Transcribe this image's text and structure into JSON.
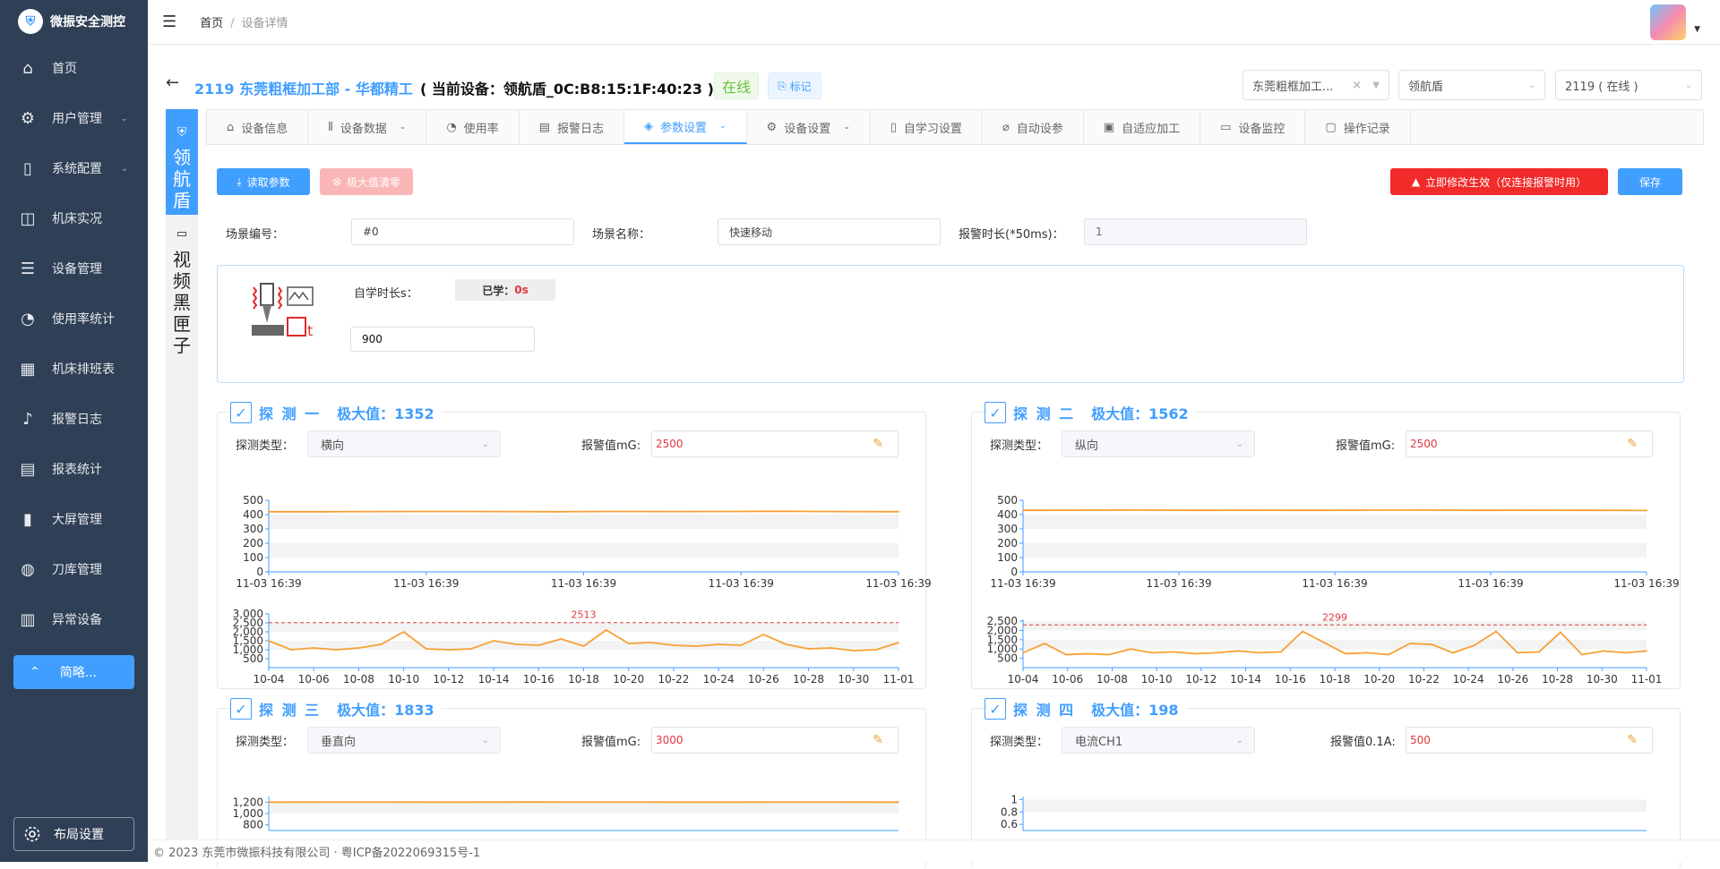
{
  "app": {
    "title": "微振安全测控"
  },
  "sidebar": {
    "items": [
      {
        "label": "首页",
        "icon": "home-icon"
      },
      {
        "label": "用户管理",
        "icon": "gear-icon",
        "has_children": true
      },
      {
        "label": "系统配置",
        "icon": "book-icon",
        "has_children": true
      },
      {
        "label": "机床实况",
        "icon": "monitor-chart-icon"
      },
      {
        "label": "设备管理",
        "icon": "list-icon"
      },
      {
        "label": "使用率统计",
        "icon": "gauge-icon"
      },
      {
        "label": "机床排班表",
        "icon": "calendar-icon"
      },
      {
        "label": "报警日志",
        "icon": "bell-icon"
      },
      {
        "label": "报表统计",
        "icon": "report-icon"
      },
      {
        "label": "大屏管理",
        "icon": "bar-chart-icon"
      },
      {
        "label": "刀库管理",
        "icon": "globe-icon"
      },
      {
        "label": "异常设备",
        "icon": "device-alert-icon"
      }
    ],
    "collapse_label": "简略...",
    "layout_label": "布局设置"
  },
  "breadcrumb": {
    "home": "首页",
    "current": "设备详情"
  },
  "header": {
    "title": "2119 东莞粗框加工部 - 华都精工",
    "device": "( 当前设备：领航盾_0C:B8:15:1F:40:23 )",
    "status": "在线",
    "mark": "标记"
  },
  "selectors": {
    "company": "东莞粗框加工...",
    "product": "领航盾",
    "machine": "2119 ( 在线 )"
  },
  "side_tabs": {
    "primary": [
      "领",
      "航",
      "盾"
    ],
    "secondary": [
      "视",
      "频",
      "黑",
      "匣",
      "子"
    ]
  },
  "tabs": [
    {
      "label": "设备信息",
      "icon": "home-icon",
      "dropdown": false,
      "active": false
    },
    {
      "label": "设备数据",
      "icon": "bar-icon",
      "dropdown": true,
      "active": false
    },
    {
      "label": "使用率",
      "icon": "pie-icon",
      "dropdown": false,
      "active": false
    },
    {
      "label": "报警日志",
      "icon": "doc-icon",
      "dropdown": false,
      "active": false
    },
    {
      "label": "参数设置",
      "icon": "layers-icon",
      "dropdown": true,
      "active": true
    },
    {
      "label": "设备设置",
      "icon": "gear-icon",
      "dropdown": true,
      "active": false
    },
    {
      "label": "自学习设置",
      "icon": "book-icon",
      "dropdown": false,
      "active": false
    },
    {
      "label": "自动设参",
      "icon": "clip-icon",
      "dropdown": false,
      "active": false
    },
    {
      "label": "自适应加工",
      "icon": "box-icon",
      "dropdown": false,
      "active": false
    },
    {
      "label": "设备监控",
      "icon": "video-icon",
      "dropdown": false,
      "active": false
    },
    {
      "label": "操作记录",
      "icon": "file-icon",
      "dropdown": false,
      "active": false
    }
  ],
  "toolbar": {
    "read_params": "读取参数",
    "clear_max": "极大值清零",
    "apply_now": "立即修改生效（仅连接报警时用）",
    "save": "保存"
  },
  "params": {
    "scene_no_label": "场景编号：",
    "scene_no": "#0",
    "scene_name_label": "场景名称：",
    "scene_name": "快速移动",
    "alarm_dur_label": "报警时长(*50ms)：",
    "alarm_dur": "1"
  },
  "learn": {
    "label": "自学时长s：",
    "learned_prefix": "已学：",
    "learned_value": "0s",
    "value": "900"
  },
  "colors": {
    "accent": "#409eff",
    "danger": "#e0393e",
    "line": "#f7a035",
    "online": "#67c23a"
  },
  "panels": [
    {
      "title": "探 测 一",
      "max_label": "极大值：1352",
      "type_label": "探测类型：",
      "type_value": "横向",
      "alarm_label": "报警值mG:",
      "alarm_value": "2500"
    },
    {
      "title": "探 测 二",
      "max_label": "极大值：1562",
      "type_label": "探测类型：",
      "type_value": "纵向",
      "alarm_label": "报警值mG:",
      "alarm_value": "2500"
    },
    {
      "title": "探 测 三",
      "max_label": "极大值：1833",
      "type_label": "探测类型：",
      "type_value": "垂直向",
      "alarm_label": "报警值mG:",
      "alarm_value": "3000"
    },
    {
      "title": "探 测 四",
      "max_label": "极大值：198",
      "type_label": "探测类型：",
      "type_value": "电流CH1",
      "alarm_label": "报警值0.1A:",
      "alarm_value": "500"
    }
  ],
  "chart_data": [
    {
      "type": "line",
      "x": [
        "11-03 16:39",
        "11-03 16:39",
        "11-03 16:39",
        "11-03 16:39",
        "11-03 16:39"
      ],
      "y_ticks": [
        0,
        100,
        200,
        300,
        400,
        500
      ],
      "ylim": [
        0,
        500
      ],
      "values": [
        420,
        420,
        421,
        422,
        421,
        420,
        422,
        421,
        422,
        423,
        421,
        420
      ]
    },
    {
      "type": "line",
      "x": [
        "10-04",
        "10-06",
        "10-08",
        "10-10",
        "10-12",
        "10-14",
        "10-16",
        "10-18",
        "10-20",
        "10-22",
        "10-24",
        "10-26",
        "10-28",
        "10-30",
        "11-01"
      ],
      "y_ticks": [
        500,
        1000,
        1500,
        2000,
        2500,
        3000
      ],
      "y_tick_labels": [
        "500",
        "1,000",
        "1,500",
        "2,000",
        "2,500",
        "3,000"
      ],
      "ylim": [
        0,
        3000
      ],
      "threshold": 2513,
      "threshold_label": "2513",
      "values": [
        1500,
        1000,
        1100,
        1000,
        1100,
        1300,
        2000,
        1050,
        1000,
        1050,
        1500,
        1300,
        1250,
        1600,
        1200,
        2100,
        1350,
        1400,
        1250,
        1200,
        1300,
        1250,
        1850,
        1300,
        1050,
        1100,
        950,
        1000,
        1400
      ]
    },
    {
      "type": "line",
      "x": [
        "11-03 16:39",
        "11-03 16:39",
        "11-03 16:39",
        "11-03 16:39",
        "11-03 16:39"
      ],
      "y_ticks": [
        0,
        100,
        200,
        300,
        400,
        500
      ],
      "ylim": [
        0,
        500
      ],
      "values": [
        430,
        431,
        432,
        430,
        431,
        430,
        431,
        432,
        430,
        431,
        430,
        429
      ]
    },
    {
      "type": "line",
      "x": [
        "10-04",
        "10-06",
        "10-08",
        "10-10",
        "10-12",
        "10-14",
        "10-16",
        "10-18",
        "10-20",
        "10-22",
        "10-24",
        "10-26",
        "10-28",
        "10-30",
        "11-01"
      ],
      "y_ticks": [
        500,
        1000,
        1500,
        2000,
        2500
      ],
      "y_tick_labels": [
        "500",
        "1,000",
        "1,500",
        "2,000",
        "2,500"
      ],
      "ylim": [
        0,
        2600
      ],
      "threshold": 2299,
      "threshold_label": "2299",
      "values": [
        800,
        1300,
        700,
        750,
        700,
        1000,
        800,
        850,
        750,
        800,
        900,
        800,
        850,
        1950,
        1350,
        750,
        800,
        700,
        1300,
        1250,
        800,
        1200,
        1950,
        800,
        850,
        1900,
        700,
        900,
        800,
        900
      ]
    },
    {
      "type": "line",
      "y_ticks": [
        800,
        1000,
        1200
      ],
      "y_tick_labels": [
        "800",
        "1,000",
        "1,200"
      ],
      "ylim": [
        700,
        1300
      ],
      "values": [
        1200,
        1201,
        1200,
        1202,
        1201,
        1200,
        1201,
        1200
      ]
    },
    {
      "type": "line",
      "y_ticks": [
        0.6,
        0.8,
        1
      ],
      "y_tick_labels": [
        "0.6",
        "0.8",
        "1"
      ],
      "ylim": [
        0.5,
        1.05
      ],
      "values": []
    }
  ],
  "footer": {
    "text": "© 2023 东莞市微振科技有限公司 · 粤ICP备2022069315号-1"
  }
}
